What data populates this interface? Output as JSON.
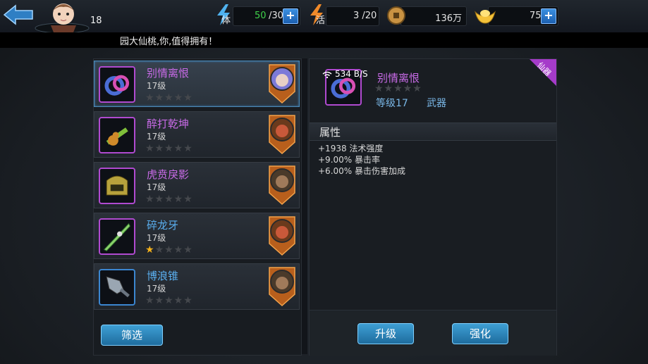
{
  "header": {
    "player_level": "18",
    "stamina": {
      "icon_label": "体",
      "current": "50",
      "max": "/30"
    },
    "vigor": {
      "icon_label": "活",
      "value": "3 /20"
    },
    "coins": {
      "value": "136万"
    },
    "ingots": {
      "value": "75"
    }
  },
  "marquee": {
    "text": "园大仙桃,你,值得拥有！"
  },
  "items": [
    {
      "name": "别情离恨",
      "level": "17级",
      "stars": 0,
      "rarity": "purple",
      "selected": true
    },
    {
      "name": "醉打乾坤",
      "level": "17级",
      "stars": 0,
      "rarity": "purple",
      "selected": false
    },
    {
      "name": "虎贲戾影",
      "level": "17级",
      "stars": 0,
      "rarity": "purple",
      "selected": false
    },
    {
      "name": "碎龙牙",
      "level": "17级",
      "stars": 1,
      "rarity": "blue",
      "selected": false
    },
    {
      "name": "博浪锥",
      "level": "17级",
      "stars": 0,
      "rarity": "blue",
      "selected": false
    }
  ],
  "left_panel": {
    "filter_label": "筛选"
  },
  "detail": {
    "net_speed": "534 B/S",
    "name": "别情离恨",
    "level_text": "等级17",
    "type_text": "武器",
    "corner_tag": "仙器",
    "attr_header": "属性",
    "attrs": [
      "+1938 法术强度",
      "+9.00% 暴击率",
      "+6.00% 暴击伤害加成"
    ],
    "upgrade_label": "升级",
    "enhance_label": "强化"
  },
  "colors": {
    "purple": "#c96be8",
    "blue": "#5aaff0",
    "button": "#2a86bd",
    "star": "#f6b21a"
  }
}
